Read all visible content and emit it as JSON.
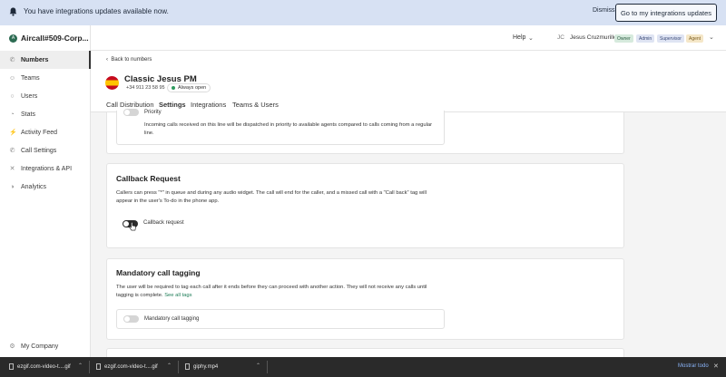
{
  "banner": {
    "message": "You have integrations updates available now.",
    "dismiss_label": "Dismiss",
    "goto_label": "Go to my integrations updates"
  },
  "sidebar": {
    "workspace_initial": "A",
    "workspace_name": "Aircall#509-Corp...",
    "items": [
      {
        "label": "Numbers",
        "icon": "phone-icon"
      },
      {
        "label": "Teams",
        "icon": "team-icon"
      },
      {
        "label": "Users",
        "icon": "user-icon"
      },
      {
        "label": "Stats",
        "icon": "stats-icon"
      },
      {
        "label": "Activity Feed",
        "icon": "activity-icon"
      },
      {
        "label": "Call Settings",
        "icon": "settings-icon"
      },
      {
        "label": "Integrations & API",
        "icon": "integrations-icon"
      },
      {
        "label": "Analytics",
        "icon": "analytics-icon"
      }
    ],
    "company_label": "My Company"
  },
  "topbar": {
    "help_label": "Help",
    "user_initials": "JC",
    "user_name": "Jesus Cruzmurillo",
    "roles": [
      "Owner",
      "Admin",
      "Supervisor",
      "Agent"
    ]
  },
  "header": {
    "back_label": "Back to numbers",
    "title": "Classic Jesus PM",
    "phone": "+34 911 23 58 95",
    "status": "Always open",
    "tabs": [
      "Call Distribution",
      "Settings",
      "Integrations",
      "Teams & Users"
    ],
    "active_tab": "Settings"
  },
  "priority": {
    "label": "Priority",
    "description": "Incoming calls received on this line will be dispatched in priority to available agents compared to calls coming from a regular line."
  },
  "callback": {
    "title": "Callback Request",
    "description": "Callers can press \"*\" in queue and during any audio widget. The call will end for the caller, and a missed call with a \"Call back\" tag will appear in the user's To-do in the phone app.",
    "toggle_label": "Callback request"
  },
  "tagging": {
    "title": "Mandatory call tagging",
    "description": "The user will be required to tag each call after it ends before they can proceed with another action. They will not receive any calls until tagging is complete.",
    "link_label": "See all tags",
    "toggle_label": "Mandatory call tagging"
  },
  "downloads": {
    "items": [
      "ezgif.com-video-t....gif",
      "ezgif.com-video-t....gif",
      "giphy.mp4"
    ],
    "show_all_label": "Mostrar todo"
  }
}
